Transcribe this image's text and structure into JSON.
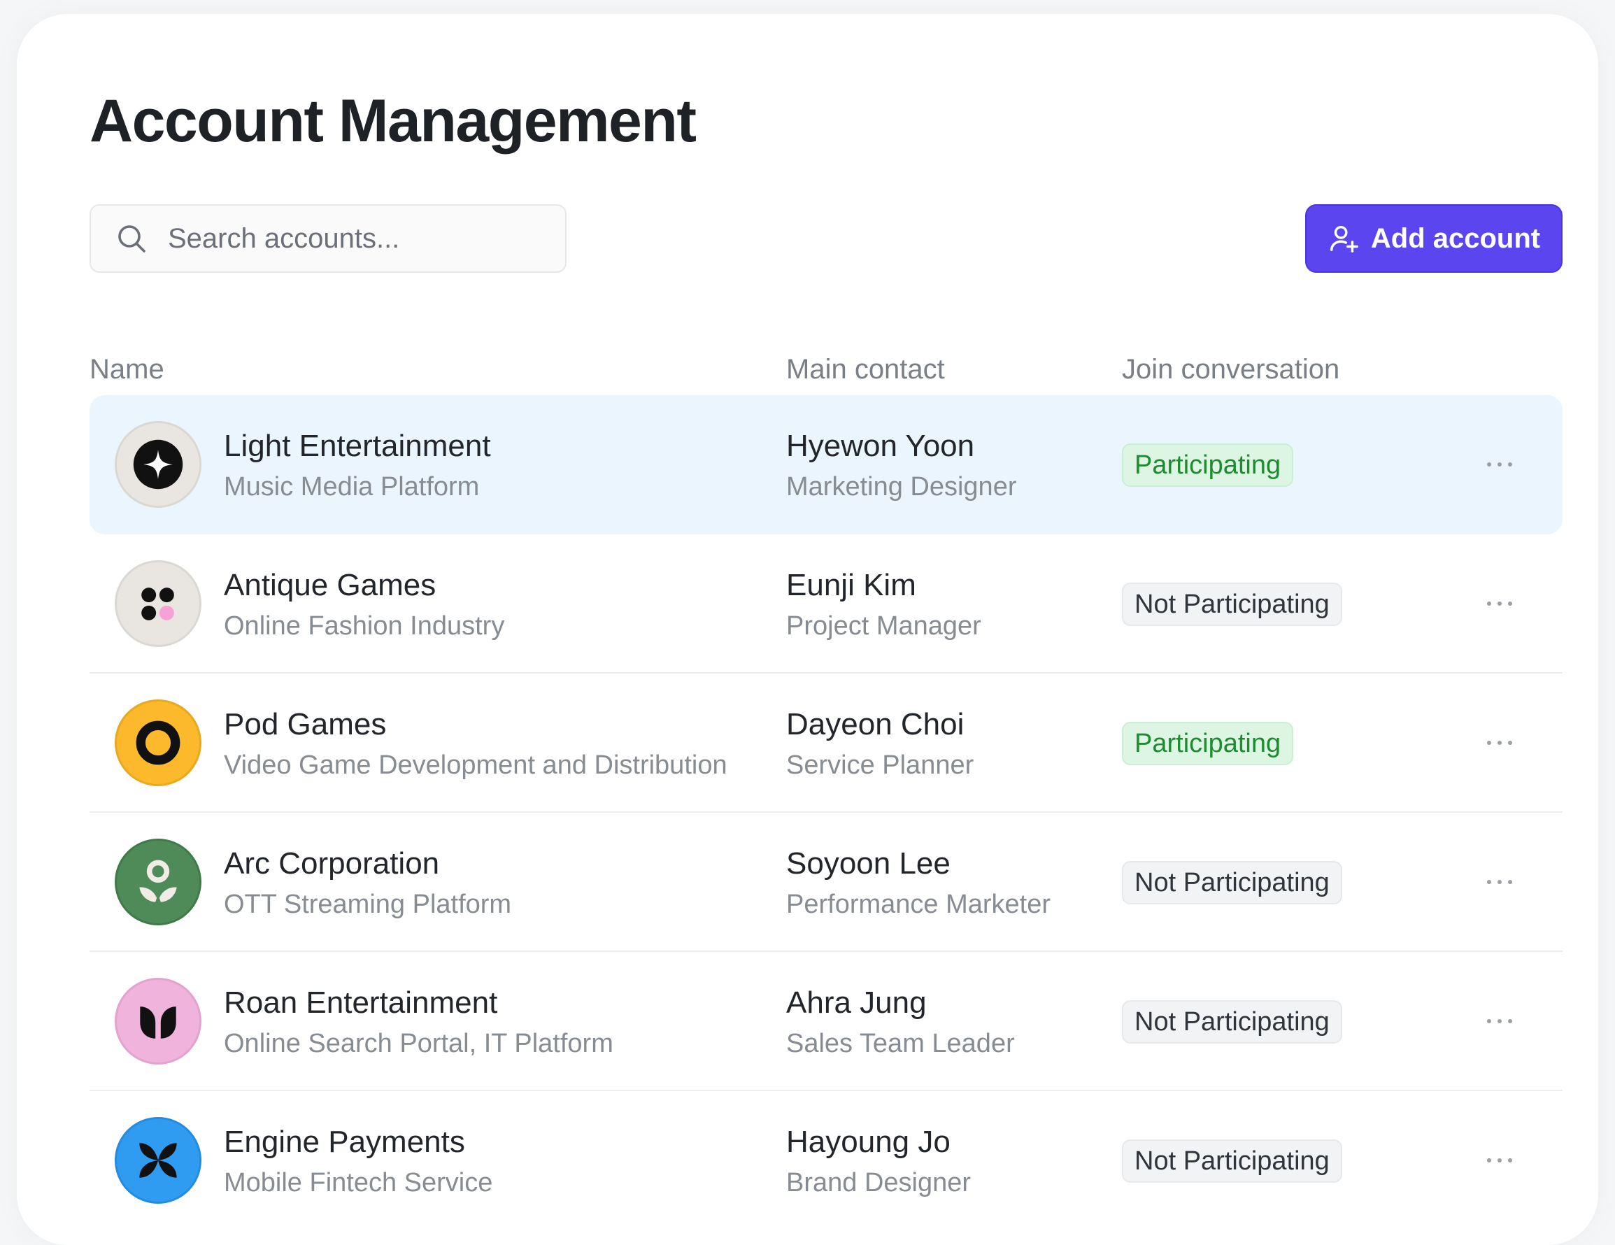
{
  "page": {
    "title": "Account Management"
  },
  "search": {
    "placeholder": "Search accounts..."
  },
  "toolbar": {
    "add_label": "Add account",
    "accent": "#5b45ee"
  },
  "table": {
    "headers": {
      "name": "Name",
      "contact": "Main contact",
      "join": "Join conversation"
    },
    "rows": [
      {
        "name": "Light Entertainment",
        "sub": "Music Media Platform",
        "contact": "Hyewon Yoon",
        "role": "Marketing Designer",
        "status": "Participating",
        "logo": "star-logo",
        "highlighted": true
      },
      {
        "name": "Antique Games",
        "sub": "Online Fashion Industry",
        "contact": "Eunji Kim",
        "role": "Project Manager",
        "status": "Not Participating",
        "logo": "four-dots-logo"
      },
      {
        "name": "Pod Games",
        "sub": "Video Game Development and Distribution",
        "contact": "Dayeon Choi",
        "role": "Service Planner",
        "status": "Participating",
        "logo": "ring-logo"
      },
      {
        "name": "Arc Corporation",
        "sub": "OTT Streaming Platform",
        "contact": "Soyoon Lee",
        "role": "Performance Marketer",
        "status": "Not Participating",
        "logo": "sprout-logo"
      },
      {
        "name": "Roan Entertainment",
        "sub": "Online Search Portal, IT Platform",
        "contact": "Ahra Jung",
        "role": "Sales Team Leader",
        "status": "Not Participating",
        "logo": "tulip-logo"
      },
      {
        "name": "Engine Payments",
        "sub": "Mobile Fintech Service",
        "contact": "Hayoung Jo",
        "role": "Brand Designer",
        "status": "Not Participating",
        "logo": "butterfly-logo"
      }
    ]
  },
  "colors": {
    "participating_bg": "#ddf6e4",
    "participating_text": "#1d8b2e",
    "not_participating_bg": "#f2f3f5",
    "highlight_row": "#eaf5fd"
  }
}
